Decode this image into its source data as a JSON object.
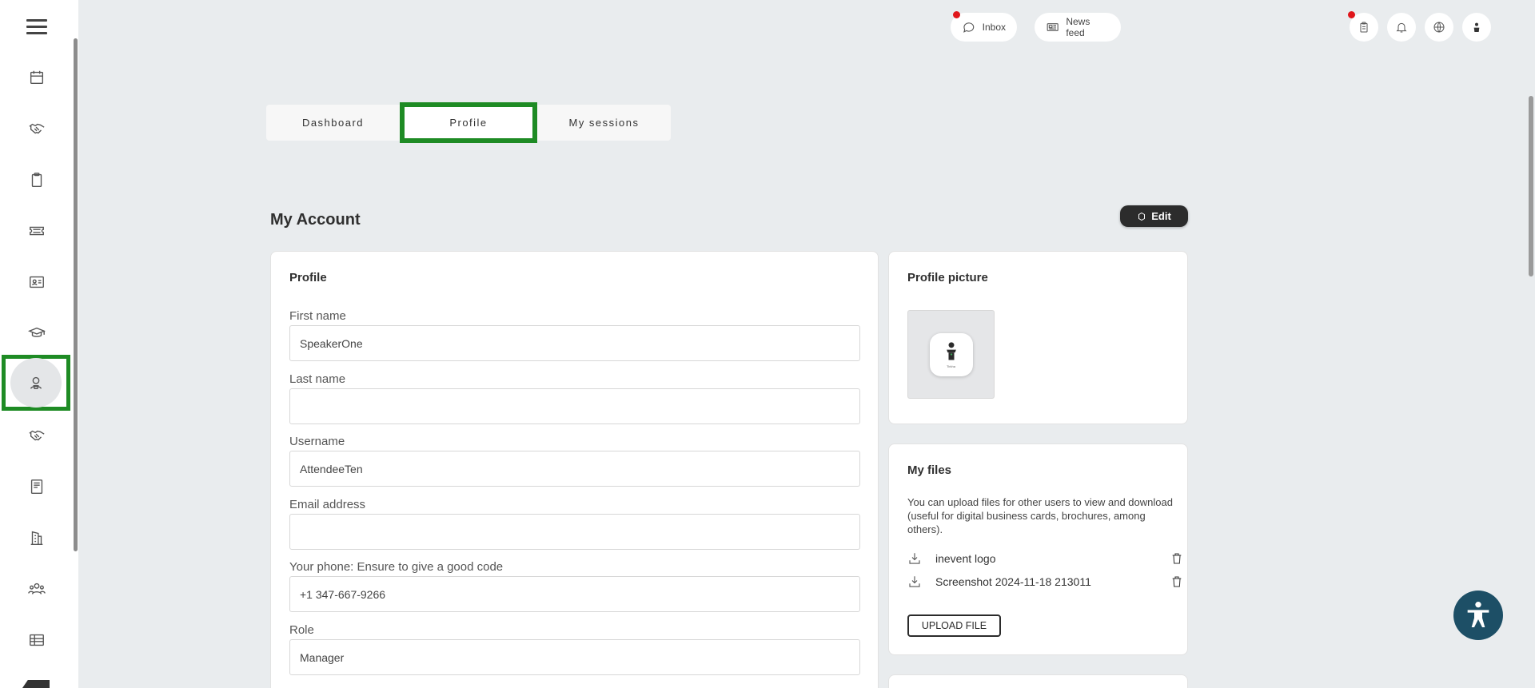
{
  "topbar": {
    "inbox_label": "Inbox",
    "newsfeed_label": "News feed"
  },
  "tabs": [
    {
      "label": "Dashboard"
    },
    {
      "label": "Profile"
    },
    {
      "label": "My sessions"
    }
  ],
  "account": {
    "heading": "My Account",
    "edit_label": "Edit"
  },
  "profile_card": {
    "title": "Profile",
    "fields": [
      {
        "label": "First name",
        "value": ""
      },
      {
        "label": "Last name",
        "value": ""
      },
      {
        "label": "Username",
        "value": ""
      },
      {
        "label": "Email address",
        "value": ""
      },
      {
        "label": "Your phone: Ensure to give a good code",
        "value": ""
      },
      {
        "label": "Role",
        "value": ""
      }
    ],
    "values": {
      "first_name": "SpeakerOne",
      "last_name": "",
      "username": "AttendeeTen",
      "email": "",
      "phone": "+1 347-667-9266",
      "role": "Manager"
    }
  },
  "picture_card": {
    "title": "Profile picture",
    "tiny_caption": "Tirkha"
  },
  "files_card": {
    "title": "My files",
    "description": "You can upload files for other users to view and download (useful for digital business cards, brochures, among others).",
    "files": [
      {
        "name": "inevent logo"
      },
      {
        "name": "Screenshot 2024-11-18 213011"
      }
    ],
    "upload_label": "UPLOAD FILE"
  },
  "colors": {
    "highlight": "#1e8b24",
    "accessibility_button": "#1d4f66",
    "notification_dot": "#e0161b"
  },
  "sidebar_icons": [
    "menu-icon",
    "calendar-icon",
    "handshake-icon",
    "clipboard-icon",
    "ticket-icon",
    "id-card-icon",
    "graduation-cap-icon",
    "speaker-icon",
    "handshake-icon",
    "book-icon",
    "building-icon",
    "people-icon",
    "table-icon"
  ]
}
